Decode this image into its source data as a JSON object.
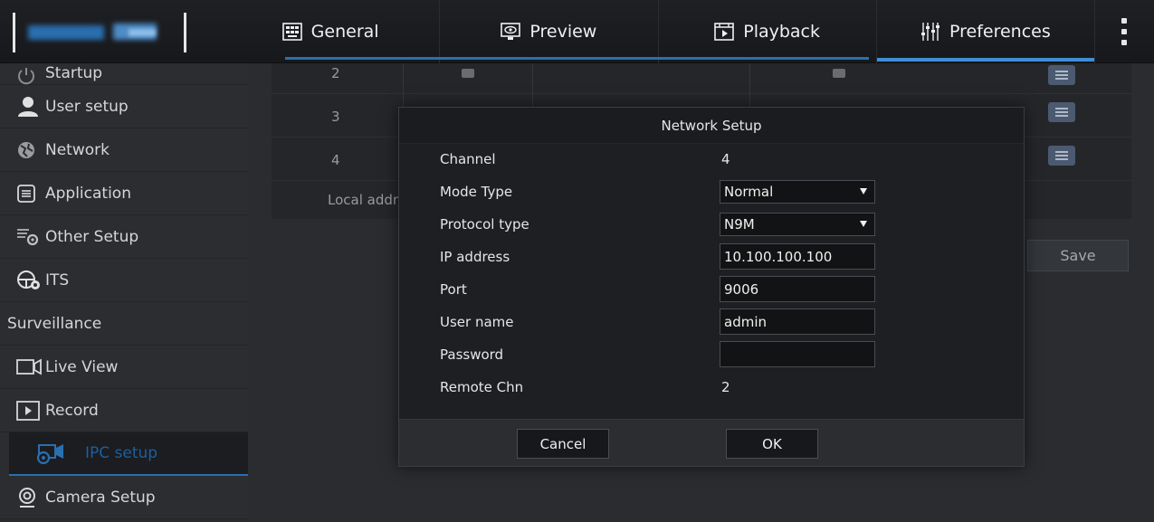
{
  "tabs": [
    {
      "label": "General",
      "icon": "general-icon"
    },
    {
      "label": "Preview",
      "icon": "preview-icon"
    },
    {
      "label": "Playback",
      "icon": "playback-icon"
    },
    {
      "label": "Preferences",
      "icon": "preferences-icon",
      "active": true
    }
  ],
  "sidebar": {
    "items": [
      {
        "label": "Startup",
        "icon": "startup-icon"
      },
      {
        "label": "User setup",
        "icon": "user-icon"
      },
      {
        "label": "Network",
        "icon": "network-icon"
      },
      {
        "label": "Application",
        "icon": "application-icon"
      },
      {
        "label": "Other Setup",
        "icon": "other-setup-icon"
      },
      {
        "label": "ITS",
        "icon": "its-icon"
      }
    ],
    "section": "Surveillance",
    "surveillance_items": [
      {
        "label": "Live View",
        "icon": "live-view-icon"
      },
      {
        "label": "Record",
        "icon": "record-icon"
      },
      {
        "label": "IPC setup",
        "icon": "ipc-setup-icon",
        "selected": true
      },
      {
        "label": "Camera Setup",
        "icon": "camera-setup-icon"
      }
    ]
  },
  "background": {
    "rows": [
      "2",
      "3",
      "4"
    ],
    "local_addr": "Local addr",
    "save_label": "Save"
  },
  "modal": {
    "title": "Network Setup",
    "channel_label": "Channel",
    "channel_value": "4",
    "mode_type_label": "Mode Type",
    "mode_type_value": "Normal",
    "protocol_label": "Protocol type",
    "protocol_value": "N9M",
    "ip_label": "IP address",
    "ip_value": "10.100.100.100",
    "port_label": "Port",
    "port_value": "9006",
    "user_label": "User name",
    "user_value": "admin",
    "password_label": "Password",
    "password_value": "",
    "remote_chn_label": "Remote Chn",
    "remote_chn_value": "2",
    "cancel_label": "Cancel",
    "ok_label": "OK"
  },
  "colors": {
    "accent": "#3e8fd6",
    "selected_text": "#1e5f9c"
  }
}
